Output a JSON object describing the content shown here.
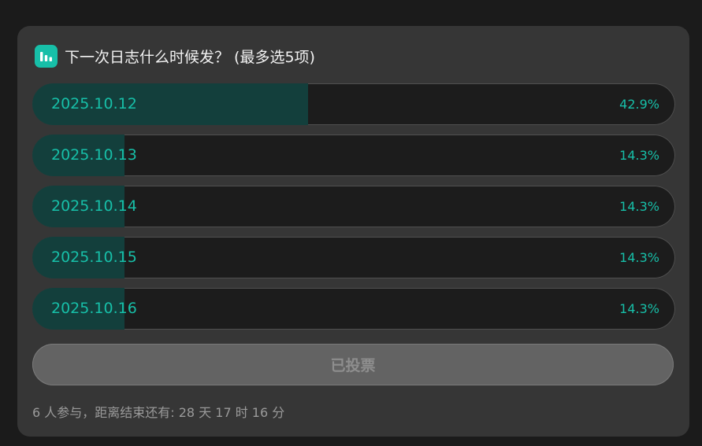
{
  "poll": {
    "icon": "bar-chart-icon",
    "title": "下一次日志什么时候发？ (最多选5项)",
    "options": [
      {
        "label": "2025.10.12",
        "percent": "42.9%",
        "fraction": 0.429
      },
      {
        "label": "2025.10.13",
        "percent": "14.3%",
        "fraction": 0.143
      },
      {
        "label": "2025.10.14",
        "percent": "14.3%",
        "fraction": 0.143
      },
      {
        "label": "2025.10.15",
        "percent": "14.3%",
        "fraction": 0.143
      },
      {
        "label": "2025.10.16",
        "percent": "14.3%",
        "fraction": 0.143
      }
    ],
    "vote_button_label": "已投票",
    "footer": "6 人参与，距离结束还有: 28 天 17 时 16 分"
  },
  "colors": {
    "accent": "#17bfa8",
    "fill": "#133f3c",
    "card": "#363636",
    "background": "#1b1b1b"
  }
}
